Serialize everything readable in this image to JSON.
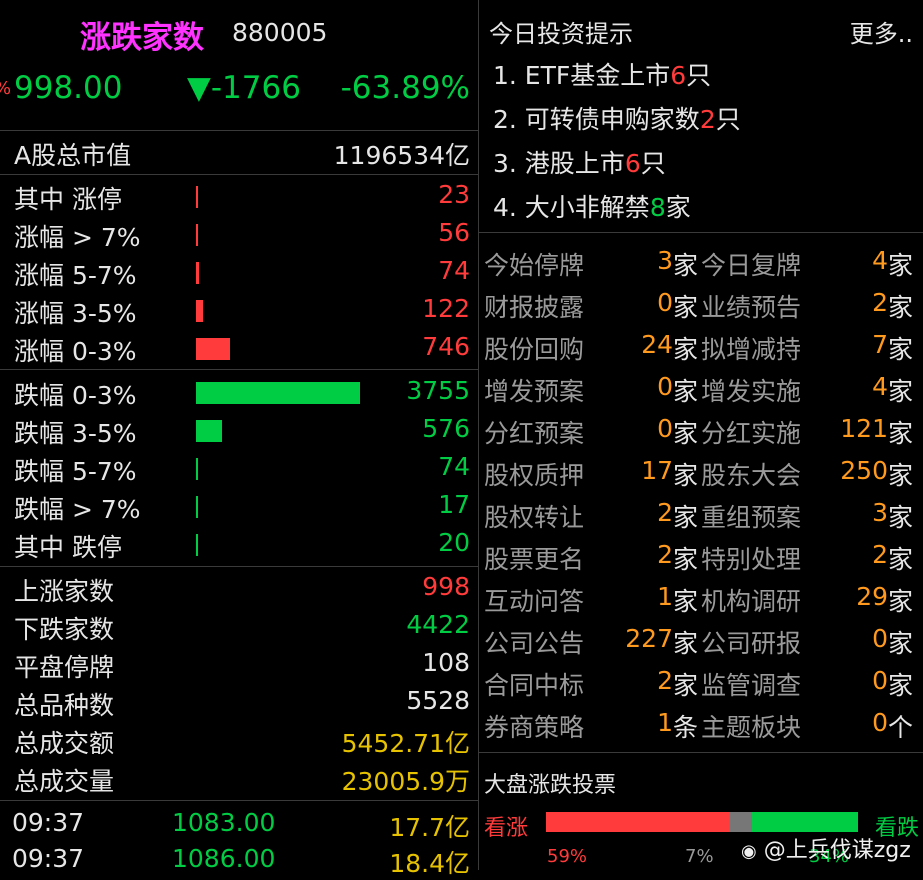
{
  "header": {
    "title": "涨跌家数",
    "code": "880005",
    "edge_mark": "%",
    "price": "998.00",
    "change": "▼-1766",
    "pct": "-63.89%"
  },
  "market_cap": {
    "label": "A股总市值",
    "value": "1196534亿"
  },
  "rise_rows": [
    {
      "label": "其中 涨停",
      "value": "23",
      "fraction": 0.005
    },
    {
      "label": "涨幅 > 7%",
      "value": "56",
      "fraction": 0.012
    },
    {
      "label": "涨幅 5-7%",
      "value": "74",
      "fraction": 0.016
    },
    {
      "label": "涨幅 3-5%",
      "value": "122",
      "fraction": 0.04
    },
    {
      "label": "涨幅 0-3%",
      "value": "746",
      "fraction": 0.21
    }
  ],
  "fall_rows": [
    {
      "label": "跌幅 0-3%",
      "value": "3755",
      "fraction": 1.0
    },
    {
      "label": "跌幅 3-5%",
      "value": "576",
      "fraction": 0.16
    },
    {
      "label": "跌幅 5-7%",
      "value": "74",
      "fraction": 0.012
    },
    {
      "label": "跌幅 > 7%",
      "value": "17",
      "fraction": 0.012
    },
    {
      "label": "其中 跌停",
      "value": "20",
      "fraction": 0.012
    }
  ],
  "summary": [
    {
      "label": "上涨家数",
      "value": "998",
      "color": "#ff3b3b"
    },
    {
      "label": "下跌家数",
      "value": "4422",
      "color": "#00cc44"
    },
    {
      "label": "平盘停牌",
      "value": "108",
      "color": "#e6e6e6"
    },
    {
      "label": "总品种数",
      "value": "5528",
      "color": "#e6e6e6"
    },
    {
      "label": "总成交额",
      "value": "5452.71亿",
      "color": "#e6c200"
    },
    {
      "label": "总成交量",
      "value": "23005.9万",
      "color": "#e6c200"
    }
  ],
  "ticks": [
    {
      "time": "09:37",
      "price": "1083.00",
      "amount": "17.7亿"
    },
    {
      "time": "09:37",
      "price": "1086.00",
      "amount": "18.4亿"
    }
  ],
  "tips_header": {
    "title": "今日投资提示",
    "more": "更多.."
  },
  "tips": [
    {
      "prefix": "1. ETF基金上市",
      "num": "6",
      "suffix": "只",
      "num_color": "#ff3b3b"
    },
    {
      "prefix": "2. 可转债申购家数",
      "num": "2",
      "suffix": "只",
      "num_color": "#ff3b3b"
    },
    {
      "prefix": "3. 港股上市",
      "num": "6",
      "suffix": "只",
      "num_color": "#ff3b3b"
    },
    {
      "prefix": "4. 大小非解禁",
      "num": "8",
      "suffix": "家",
      "num_color": "#00cc44"
    }
  ],
  "events": [
    {
      "l": "今始停牌",
      "lc": "3",
      "lu": "家",
      "r": "今日复牌",
      "rc": "4",
      "ru": "家"
    },
    {
      "l": "财报披露",
      "lc": "0",
      "lu": "家",
      "r": "业绩预告",
      "rc": "2",
      "ru": "家"
    },
    {
      "l": "股份回购",
      "lc": "24",
      "lu": "家",
      "r": "拟增减持",
      "rc": "7",
      "ru": "家"
    },
    {
      "l": "增发预案",
      "lc": "0",
      "lu": "家",
      "r": "增发实施",
      "rc": "4",
      "ru": "家"
    },
    {
      "l": "分红预案",
      "lc": "0",
      "lu": "家",
      "r": "分红实施",
      "rc": "121",
      "ru": "家"
    },
    {
      "l": "股权质押",
      "lc": "17",
      "lu": "家",
      "r": "股东大会",
      "rc": "250",
      "ru": "家"
    },
    {
      "l": "股权转让",
      "lc": "2",
      "lu": "家",
      "r": "重组预案",
      "rc": "3",
      "ru": "家"
    },
    {
      "l": "股票更名",
      "lc": "2",
      "lu": "家",
      "r": "特别处理",
      "rc": "2",
      "ru": "家"
    },
    {
      "l": "互动问答",
      "lc": "1",
      "lu": "家",
      "r": "机构调研",
      "rc": "29",
      "ru": "家"
    },
    {
      "l": "公司公告",
      "lc": "227",
      "lu": "家",
      "r": "公司研报",
      "rc": "0",
      "ru": "家"
    },
    {
      "l": "合同中标",
      "lc": "2",
      "lu": "家",
      "r": "监管调查",
      "rc": "0",
      "ru": "家"
    },
    {
      "l": "券商策略",
      "lc": "1",
      "lu": "条",
      "r": "主题板块",
      "rc": "0",
      "ru": "个"
    }
  ],
  "vote": {
    "title": "大盘涨跌投票",
    "bull_label": "看涨",
    "bear_label": "看跌",
    "bull_pct": "59%",
    "neutral_pct": "7%",
    "bear_pct": "34%",
    "bull_fraction": 0.59,
    "neutral_fraction": 0.07,
    "bear_fraction": 0.34
  },
  "watermark": "@上兵伐谋zgz",
  "colors": {
    "up": "#ff3b3b",
    "down": "#00cc44",
    "accent": "#ff33ff",
    "count": "#ff9a1f",
    "yellow": "#e6c200"
  }
}
